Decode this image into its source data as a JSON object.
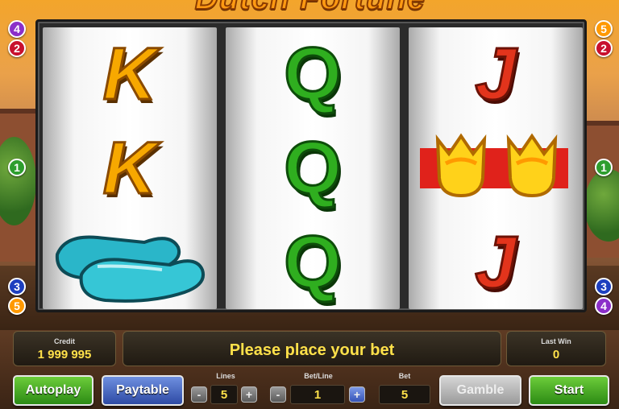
{
  "game": {
    "title": "Dutch Fortune"
  },
  "reels": [
    {
      "symbols": [
        "K",
        "K",
        "clog"
      ]
    },
    {
      "symbols": [
        "Q",
        "Q",
        "Q"
      ]
    },
    {
      "symbols": [
        "J",
        "tulip",
        "J"
      ]
    }
  ],
  "symbol_icons": {
    "clog": "clog-icon",
    "tulip": "tulip-icon"
  },
  "paylines": {
    "left": [
      "4",
      "2",
      "1",
      "3",
      "5"
    ],
    "right": [
      "5",
      "2",
      "1",
      "3",
      "4"
    ]
  },
  "payline_colors": {
    "1": "#2e9e2e",
    "2": "#c8102e",
    "3": "#1d3fbf",
    "4": "#8b2fc9",
    "5": "#ff9900"
  },
  "credit": {
    "label": "Credit",
    "value": "1 999 995"
  },
  "message": "Please place your bet",
  "last_win": {
    "label": "Last Win",
    "value": "0"
  },
  "controls": {
    "autoplay": "Autoplay",
    "paytable": "Paytable",
    "gamble": "Gamble",
    "start": "Start",
    "lines": {
      "label": "Lines",
      "value": "5",
      "minus": "-",
      "plus": "+"
    },
    "bet_line": {
      "label": "Bet/Line",
      "value": "1",
      "minus": "-",
      "plus": "+"
    },
    "bet": {
      "label": "Bet",
      "value": "5"
    }
  }
}
